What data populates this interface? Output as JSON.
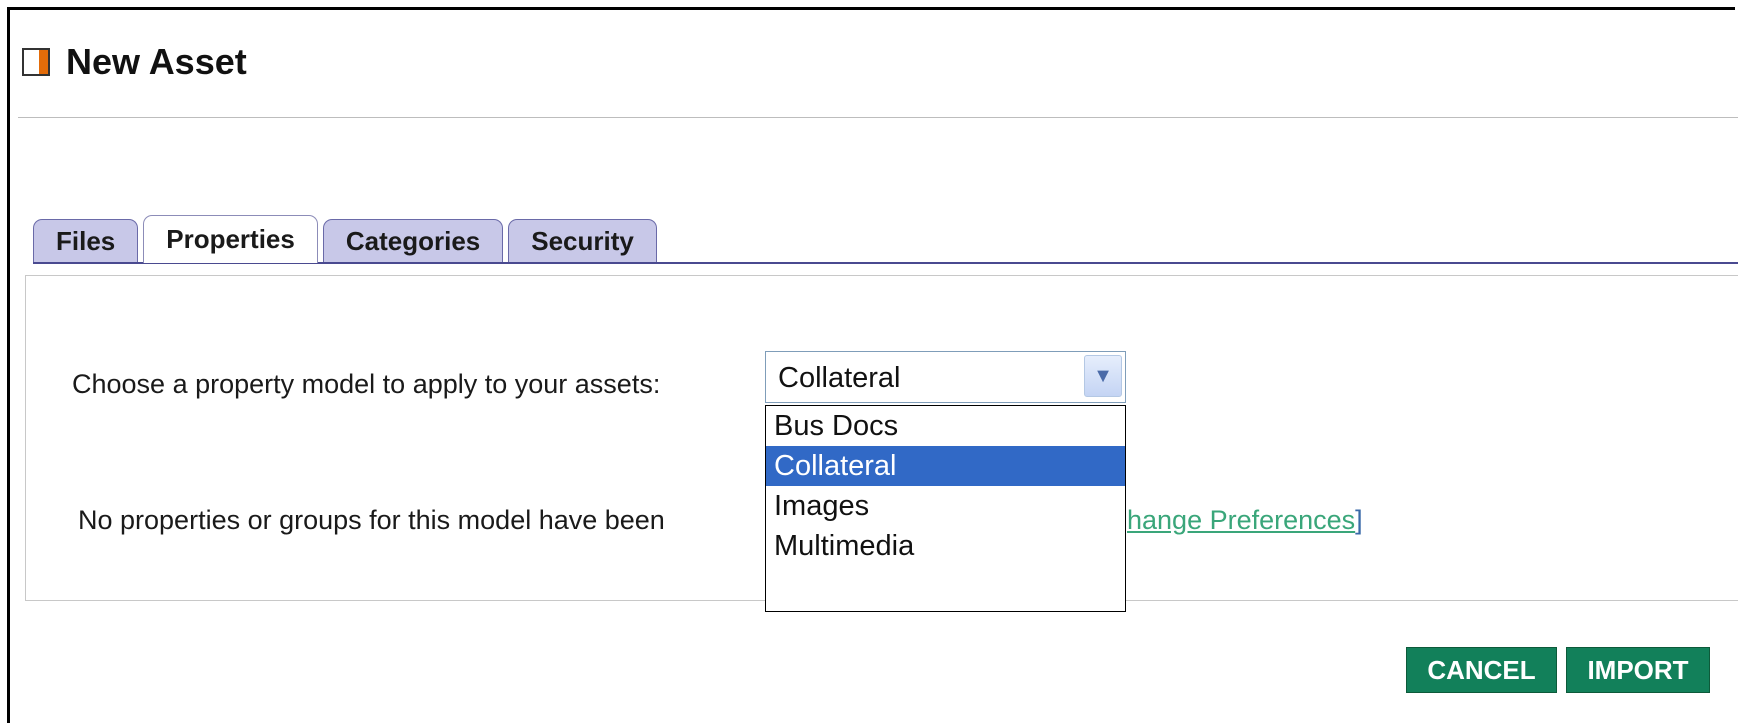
{
  "window": {
    "title": "New Asset",
    "icon": "page-icon"
  },
  "tabs": [
    {
      "label": "Files",
      "active": false
    },
    {
      "label": "Properties",
      "active": true
    },
    {
      "label": "Categories",
      "active": false
    },
    {
      "label": "Security",
      "active": false
    }
  ],
  "properties": {
    "choose_label": "Choose a property model to apply to your assets:",
    "select": {
      "value": "Collateral",
      "options": [
        "Bus Docs",
        "Collateral",
        "Images",
        "Multimedia"
      ],
      "highlighted_option": "Collateral",
      "expanded": true
    },
    "message": "No properties or groups for this model have been ",
    "change_prefs_link": "Change Preferences",
    "change_prefs_link_visible": "hange Preferences",
    "bracket_close": "]"
  },
  "buttons": {
    "cancel_label": "CANCEL",
    "import_label": "IMPORT"
  },
  "colors": {
    "accent": "#e36c0a",
    "tab_bg": "#c8c8e8",
    "button_green": "#12805a",
    "highlight_blue": "#3169c6",
    "link_green": "#3aa67a"
  }
}
